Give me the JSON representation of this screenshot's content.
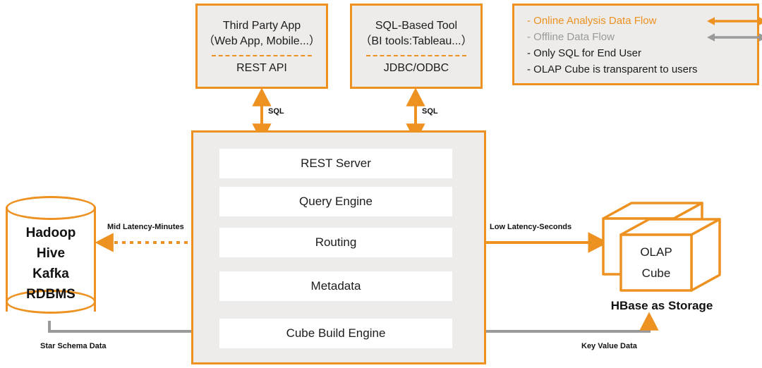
{
  "colors": {
    "orange": "#ED9121",
    "gray": "#9a9a9a",
    "panel_bg": "#EDECEA",
    "layer_bg": "#FFFFFF",
    "text": "#1c1c1c"
  },
  "clients": [
    {
      "title": "Third Party App\n（Web App, Mobile...）",
      "protocol": "REST API"
    },
    {
      "title": "SQL-Based Tool\n（BI tools:Tableau...）",
      "protocol": "JDBC/ODBC"
    }
  ],
  "legend": {
    "items": [
      {
        "label": "- Online Analysis Data Flow",
        "style": "orange",
        "arrow": "double-arrow-orange"
      },
      {
        "label": "- Offline Data Flow",
        "style": "gray",
        "arrow": "double-arrow-gray"
      },
      {
        "label": "- Only SQL for End User",
        "style": "black",
        "arrow": ""
      },
      {
        "label": "- OLAP Cube is transparent to users",
        "style": "black",
        "arrow": ""
      }
    ]
  },
  "server": {
    "layers": [
      "REST Server",
      "Query Engine",
      "Routing",
      "Metadata",
      "Cube Build Engine"
    ]
  },
  "source_store": {
    "lines": [
      "Hadoop",
      "Hive",
      "Kafka",
      "RDBMS"
    ]
  },
  "cube": {
    "label_line1": "OLAP",
    "label_line2": "Cube",
    "caption": "HBase  as Storage"
  },
  "connectors": {
    "sql_left": "SQL",
    "sql_right": "SQL",
    "mid_latency": "Mid Latency-Minutes",
    "low_latency": "Low Latency-Seconds",
    "star_schema": "Star Schema Data",
    "key_value": "Key Value Data"
  }
}
